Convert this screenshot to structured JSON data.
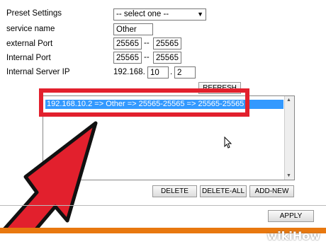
{
  "form": {
    "preset_label": "Preset Settings",
    "preset_value": "-- select one --",
    "service_label": "service name",
    "service_value": "Other",
    "external_label": "external Port",
    "external_start": "25565",
    "external_end": "25565",
    "internal_label": "Internal Port",
    "internal_start": "25565",
    "internal_end": "25565",
    "ip_label": "Internal Server IP",
    "ip_prefix": "192.168.",
    "ip_octet3": "10",
    "ip_octet4": "2",
    "range_sep": "--",
    "dot": "."
  },
  "buttons": {
    "refresh": "REFRESH",
    "delete": "DELETE",
    "delete_all": "DELETE-ALL",
    "add_new": "ADD-NEW",
    "apply": "APPLY"
  },
  "list": {
    "entries": [
      "192.168.10.2 => Other => 25565-25565 => 25565-25565"
    ]
  },
  "watermark": "wikiHow",
  "colors": {
    "highlight": "#3399ff",
    "annotation_red": "#e2202d",
    "footer_orange": "#e8780f"
  }
}
